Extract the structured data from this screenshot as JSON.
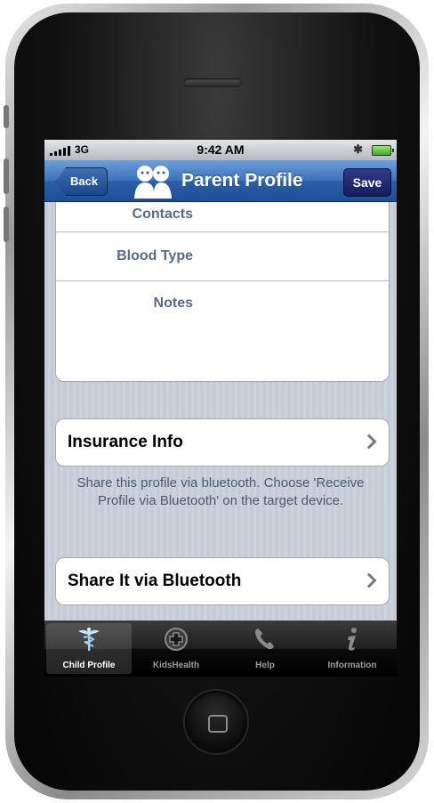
{
  "status_bar": {
    "carrier": "3G",
    "time": "9:42 AM"
  },
  "nav_bar": {
    "back_label": "Back",
    "title": "Parent Profile",
    "save_label": "Save"
  },
  "profile_fields": [
    {
      "label": "Contacts",
      "value": ""
    },
    {
      "label": "Blood Type",
      "value": ""
    },
    {
      "label": "Notes",
      "value": ""
    }
  ],
  "insurance_row": {
    "label": "Insurance Info"
  },
  "share_info": "Share this profile via bluetooth. Choose 'Receive Profile via Bluetooth' on the target device.",
  "share_row": {
    "label": "Share It via Bluetooth"
  },
  "tabs": [
    {
      "label": "Child Profile",
      "icon": "caduceus-icon",
      "selected": true
    },
    {
      "label": "KidsHealth",
      "icon": "medical-cross-icon",
      "selected": false
    },
    {
      "label": "Help",
      "icon": "phone-icon",
      "selected": false
    },
    {
      "label": "Information",
      "icon": "info-icon",
      "selected": false
    }
  ],
  "colors": {
    "nav_bar": "#2b5fa8",
    "save_button": "#1e2a70",
    "field_label": "#556b8e",
    "background": "#c6ccd6"
  }
}
